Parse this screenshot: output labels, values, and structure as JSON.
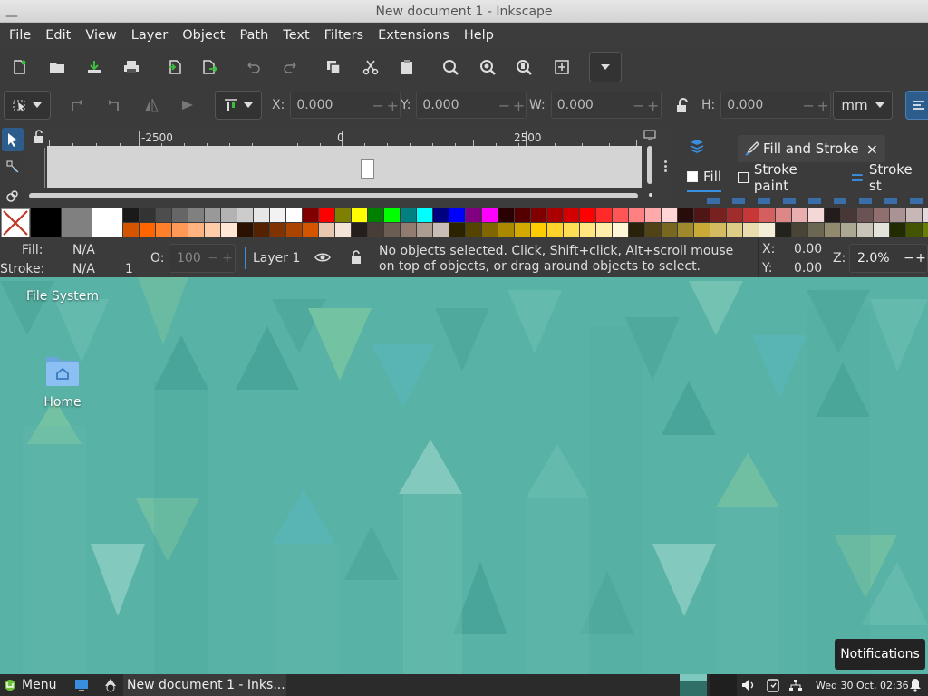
{
  "window": {
    "title": "New document 1 - Inkscape"
  },
  "menu": [
    "File",
    "Edit",
    "View",
    "Layer",
    "Object",
    "Path",
    "Text",
    "Filters",
    "Extensions",
    "Help"
  ],
  "controls": {
    "x_label": "X:",
    "x_value": "0.000",
    "y_label": "Y:",
    "y_value": "0.000",
    "w_label": "W:",
    "w_value": "0.000",
    "h_label": "H:",
    "h_value": "0.000",
    "unit": "mm"
  },
  "ruler": {
    "labels": [
      "-2500",
      "0",
      "2500"
    ]
  },
  "dock": {
    "tab_title": "Fill and Stroke",
    "close_glyph": "×",
    "subtabs": {
      "fill": "Fill",
      "stroke_paint": "Stroke paint",
      "stroke_style": "Stroke st"
    }
  },
  "palette": {
    "big": [
      "#000000",
      "#808080",
      "#ffffff"
    ],
    "row1": [
      "#1a1a1a",
      "#333333",
      "#4d4d4d",
      "#666666",
      "#808080",
      "#999999",
      "#b3b3b3",
      "#cccccc",
      "#e6e6e6",
      "#f2f2f2",
      "#ffffff",
      "#800000",
      "#ff0000",
      "#808000",
      "#ffff00",
      "#008000",
      "#00ff00",
      "#008080",
      "#00ffff",
      "#000080",
      "#0000ff",
      "#800080",
      "#ff00ff",
      "#2b0000",
      "#550000",
      "#800000",
      "#aa0000",
      "#d40000",
      "#ff0000",
      "#ff2a2a",
      "#ff5555",
      "#ff8080",
      "#ffaaaa",
      "#ffd5d5",
      "#280b0b",
      "#501616",
      "#782121",
      "#a02c2c",
      "#c83737",
      "#d35f5f",
      "#de8787",
      "#e9afaf",
      "#f4d7d7",
      "#241c1c",
      "#483737",
      "#6c5353",
      "#916f6f",
      "#ac9393",
      "#c8b7b7",
      "#e3dbdb"
    ],
    "row2": [
      "#d45500",
      "#ff6600",
      "#ff7f2a",
      "#ff9955",
      "#ffb380",
      "#ffccaa",
      "#ffe6d5",
      "#2b1100",
      "#552200",
      "#803300",
      "#aa4400",
      "#d45500",
      "#e9c6af",
      "#f4e3d7",
      "#241f1c",
      "#483e37",
      "#6c5d53",
      "#917c6f",
      "#ac9d93",
      "#c8beb7",
      "#2b2200",
      "#554400",
      "#806600",
      "#aa8800",
      "#d4aa00",
      "#ffcc00",
      "#ffd42a",
      "#ffdd55",
      "#ffe680",
      "#ffeeaa",
      "#fff6d5",
      "#28220b",
      "#504416",
      "#786721",
      "#a0892c",
      "#c8ab37",
      "#d3bc5f",
      "#decd87",
      "#e9ddaf",
      "#f4eed7",
      "#24221c",
      "#484537",
      "#6c6753",
      "#918a6f",
      "#aca793",
      "#c8c4b7",
      "#e3e2db",
      "#222b00",
      "#445500",
      "#668000",
      "#88aa00"
    ]
  },
  "status": {
    "fill_label": "Fill:",
    "fill_value": "N/A",
    "stroke_label": "Stroke:",
    "stroke_value": "N/A",
    "stroke_width": "1",
    "opacity_label": "O:",
    "opacity_value": "100",
    "layer": "Layer 1",
    "message": "No objects selected. Click, Shift+click, Alt+scroll mouse on top of objects, or drag around objects to select.",
    "x_label": "X:",
    "x_value": "0.00",
    "y_label": "Y:",
    "y_value": "0.00",
    "zoom_label": "Z:",
    "zoom_value": "2.0%"
  },
  "desktop": {
    "icons": [
      {
        "label": "File System"
      },
      {
        "label": "Home"
      }
    ]
  },
  "taskbar": {
    "menu_label": "Menu",
    "task_label": "New document 1 - Inks...",
    "clock": "Wed 30 Oct, 02:36"
  },
  "notification": {
    "label": "Notifications"
  },
  "colors": {
    "accent": "#2d5d8c",
    "desktop_bg": "#58b2a6"
  }
}
